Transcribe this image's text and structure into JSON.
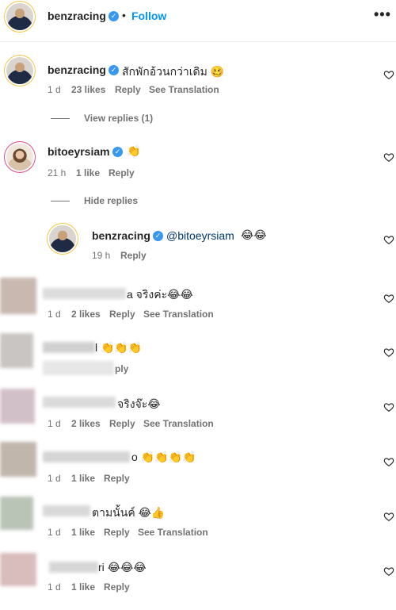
{
  "header": {
    "username": "benzracing",
    "separator": "•",
    "follow_label": "Follow",
    "more_label": "•••"
  },
  "comments": [
    {
      "username": "benzracing",
      "text": "สักพักอ้วนกว่าเดิม 🥴",
      "time": "1 d",
      "likes": "23 likes",
      "reply": "Reply",
      "translate": "See Translation"
    },
    {
      "thread_label": "View replies (1)"
    },
    {
      "username": "bitoeyrsiam",
      "text": "👏",
      "time": "21 h",
      "likes": "1 like",
      "reply": "Reply"
    },
    {
      "thread_label": "Hide replies"
    },
    {
      "username": "benzracing",
      "mention": "@bitoeyrsiam",
      "text": "😂😂",
      "time": "19 h",
      "reply": "Reply"
    },
    {
      "text": "a จริงค่ะ😂😂",
      "time": "1 d",
      "likes": "2 likes",
      "reply": "Reply",
      "translate": "See Translation"
    },
    {
      "text": "l 👏👏👏",
      "reply": "ply"
    },
    {
      "text": "จริงจ๊ะ😂",
      "time": "1 d",
      "likes": "2 likes",
      "reply": "Reply",
      "translate": "See Translation"
    },
    {
      "text": "o 👏👏👏👏",
      "time": "1 d",
      "likes": "1 like",
      "reply": "Reply"
    },
    {
      "text": "ตามนั้นค์ 😂👍",
      "time": "1 d",
      "likes": "1 like",
      "reply": "Reply",
      "translate": "See Translation"
    },
    {
      "text": "ri 😂😂😂",
      "time": "1 d",
      "likes": "1 like",
      "reply": "Reply"
    }
  ],
  "colors": {
    "accent": "#0095f6",
    "verified": "#3897f0",
    "muted": "#737373"
  },
  "icons": {
    "heart": "heart-icon",
    "verified": "verified-badge-icon",
    "more": "more-options-icon"
  }
}
